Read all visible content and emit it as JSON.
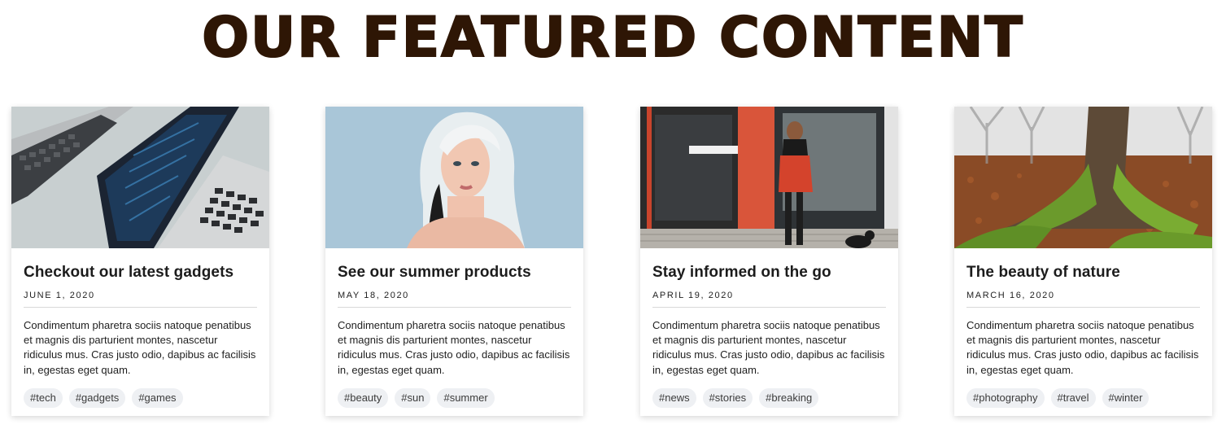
{
  "header": {
    "title": "OUR FEATURED CONTENT"
  },
  "cards": [
    {
      "image": "laptop-keyboard-photo",
      "title": "Checkout our latest gadgets",
      "date": "JUNE 1, 2020",
      "text": "Condimentum pharetra sociis natoque penatibus et magnis dis parturient montes, nascetur ridiculus mus. Cras justo odio, dapibus ac facilisis in, egestas eget quam.",
      "tags": [
        "#tech",
        "#gadgets",
        "#games"
      ]
    },
    {
      "image": "blonde-woman-portrait-photo",
      "title": "See our summer products",
      "date": "MAY 18, 2020",
      "text": "Condimentum pharetra sociis natoque penatibus et magnis dis parturient montes, nascetur ridiculus mus. Cras justo odio, dapibus ac facilisis in, egestas eget quam.",
      "tags": [
        "#beauty",
        "#sun",
        "#summer"
      ]
    },
    {
      "image": "woman-walking-dog-storefront-photo",
      "title": "Stay informed on the go",
      "date": "APRIL 19, 2020",
      "text": "Condimentum pharetra sociis natoque penatibus et magnis dis parturient montes, nascetur ridiculus mus. Cras justo odio, dapibus ac facilisis in, egestas eget quam.",
      "tags": [
        "#news",
        "#stories",
        "#breaking"
      ]
    },
    {
      "image": "mossy-tree-foggy-forest-photo",
      "title": "The beauty of nature",
      "date": "MARCH 16, 2020",
      "text": "Condimentum pharetra sociis natoque penatibus et magnis dis parturient montes, nascetur ridiculus mus. Cras justo odio, dapibus ac facilisis in, egestas eget quam.",
      "tags": [
        "#photography",
        "#travel",
        "#winter"
      ]
    }
  ]
}
